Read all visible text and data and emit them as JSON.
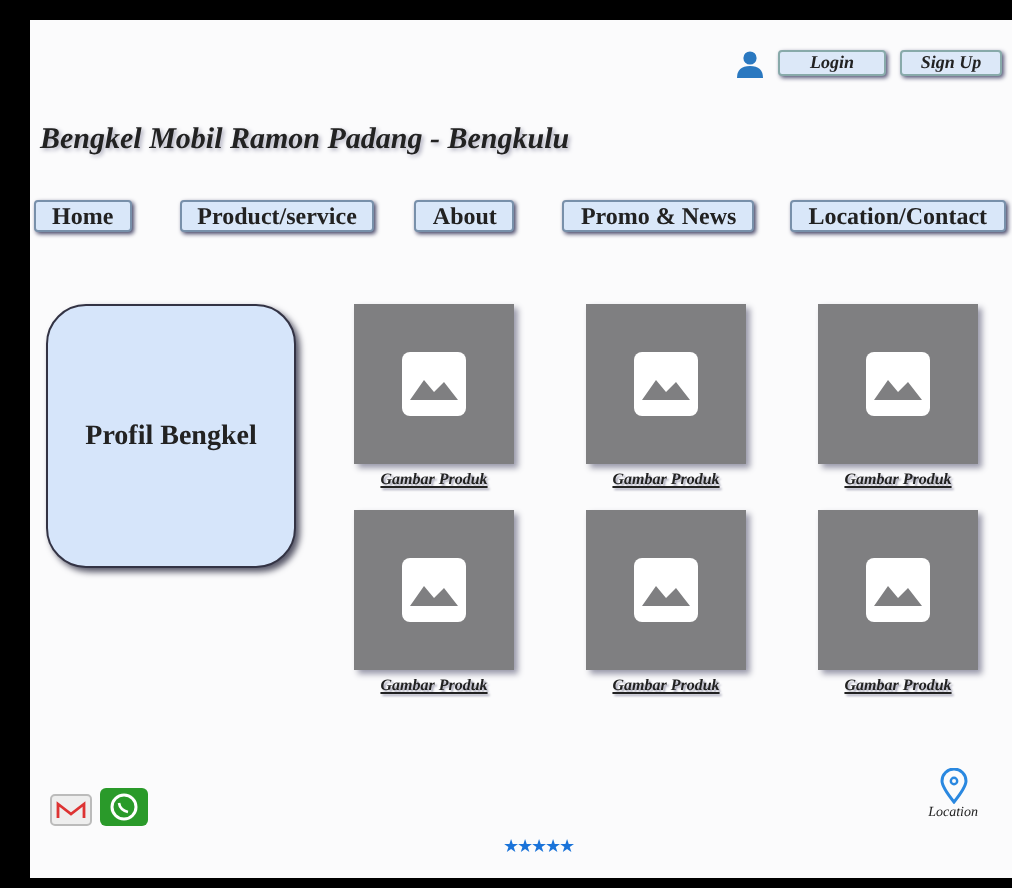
{
  "header": {
    "buttons": [
      "Login",
      "Sign Up"
    ]
  },
  "site_title": "Bengkel Mobil Ramon Padang - Bengkulu",
  "nav": [
    {
      "label": "Home"
    },
    {
      "label": "Product/service"
    },
    {
      "label": "About"
    },
    {
      "label": "Promo & News"
    },
    {
      "label": "Location/Contact"
    }
  ],
  "profile": {
    "label": "Profil Bengkel"
  },
  "products": [
    {
      "caption": "Gambar Produk"
    },
    {
      "caption": "Gambar Produk"
    },
    {
      "caption": "Gambar Produk"
    },
    {
      "caption": "Gambar Produk"
    },
    {
      "caption": "Gambar Produk"
    },
    {
      "caption": "Gambar Produk"
    }
  ],
  "footer": {
    "rating": {
      "stars": 5
    },
    "location_label": "Location"
  }
}
